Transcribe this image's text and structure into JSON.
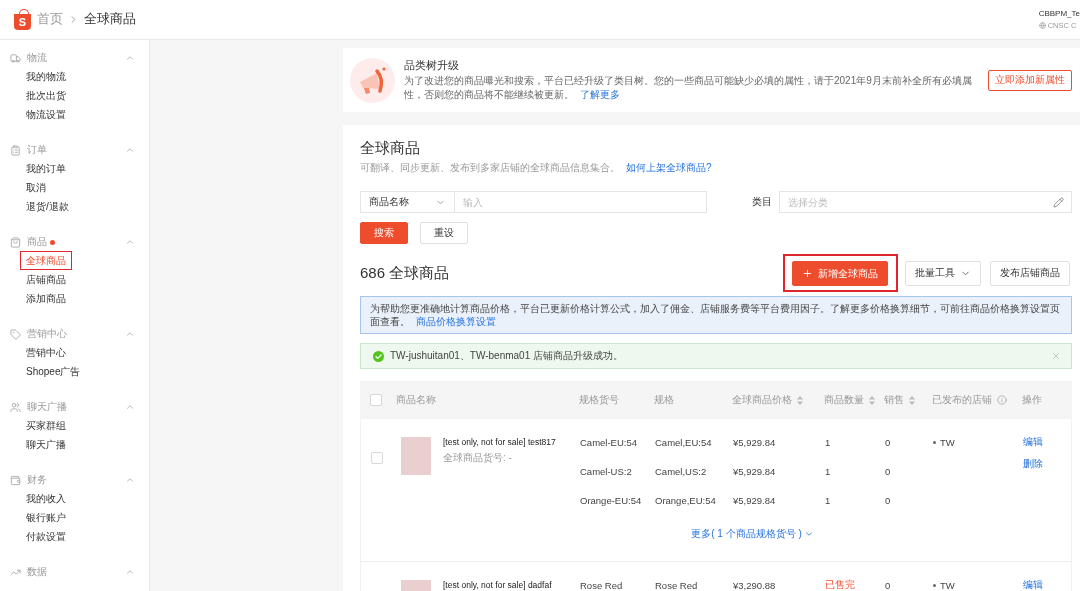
{
  "header": {
    "logo_text": "S",
    "breadcrumb": [
      {
        "label": "首页"
      },
      {
        "label": "全球商品"
      }
    ],
    "account": {
      "name": "CBBPM_Te",
      "shop": "CNSC C"
    }
  },
  "sidebar": {
    "groups": [
      {
        "label": "物流",
        "has_dot": false,
        "expanded": true,
        "items": [
          {
            "label": "我的物流",
            "selected": false
          },
          {
            "label": "批次出货",
            "selected": false
          },
          {
            "label": "物流设置",
            "selected": false
          }
        ]
      },
      {
        "label": "订单",
        "has_dot": false,
        "expanded": true,
        "items": [
          {
            "label": "我的订单",
            "selected": false
          },
          {
            "label": "取消",
            "selected": false
          },
          {
            "label": "退货/退款",
            "selected": false
          }
        ]
      },
      {
        "label": "商品",
        "has_dot": true,
        "expanded": true,
        "items": [
          {
            "label": "全球商品",
            "selected": true
          },
          {
            "label": "店铺商品",
            "selected": false
          },
          {
            "label": "添加商品",
            "selected": false
          }
        ]
      },
      {
        "label": "营销中心",
        "has_dot": false,
        "expanded": true,
        "items": [
          {
            "label": "营销中心",
            "selected": false
          },
          {
            "label": "Shopee广告",
            "selected": false
          }
        ]
      },
      {
        "label": "聊天广播",
        "has_dot": false,
        "expanded": true,
        "items": [
          {
            "label": "买家群组",
            "selected": false
          },
          {
            "label": "聊天广播",
            "selected": false
          }
        ]
      },
      {
        "label": "财务",
        "has_dot": false,
        "expanded": true,
        "items": [
          {
            "label": "我的收入",
            "selected": false
          },
          {
            "label": "银行账户",
            "selected": false
          },
          {
            "label": "付款设置",
            "selected": false
          }
        ]
      },
      {
        "label": "数据",
        "has_dot": false,
        "expanded": true
      }
    ]
  },
  "notice": {
    "title": "品类树升级",
    "text": "为了改进您的商品曝光和搜索，平台已经升级了类目树。您的一些商品可能缺少必填的属性，请于2021年9月末前补全所有必填属性，否则您的商品将不能继续被更新。",
    "link": "了解更多",
    "button": "立即添加新属性"
  },
  "page": {
    "title": "全球商品",
    "subtitle": "可翻译、同步更新、发布到多家店铺的全球商品信息集合。",
    "help_link": "如何上架全球商品?"
  },
  "filters": {
    "type_select": "商品名称",
    "keyword": {
      "placeholder": "输入"
    },
    "category_label": "类目",
    "category": {
      "placeholder": "选择分类"
    },
    "buttons": [
      {
        "kind": "primary",
        "label": "搜索"
      },
      {
        "kind": "default",
        "label": "重设"
      }
    ]
  },
  "list_header": {
    "count_title": "686 全球商品",
    "actions": [
      {
        "kind": "primary",
        "label": "新增全球商品",
        "highlighted": true
      },
      {
        "kind": "dropdown",
        "label": "批量工具",
        "highlighted": false
      },
      {
        "kind": "default",
        "label": "发布店铺商品",
        "highlighted": false
      }
    ]
  },
  "price_notice": {
    "text": "为帮助您更准确地计算商品价格，平台已更新价格计算公式，加入了佣金、店铺服务费等平台费用因子。了解更多价格换算细节，可前往商品价格换算设置页面查看。",
    "link": "商品价格换算设置"
  },
  "success_alert": {
    "text": "TW-jushuitan01、TW-benma01 店铺商品升级成功。"
  },
  "table": {
    "all_checked": false,
    "columns": [
      {
        "label": "商品名称",
        "sortable": false,
        "info": false
      },
      {
        "label": "规格货号",
        "sortable": false,
        "info": false
      },
      {
        "label": "规格",
        "sortable": false,
        "info": false
      },
      {
        "label": "全球商品价格",
        "sortable": true,
        "info": false
      },
      {
        "label": "商品数量",
        "sortable": true,
        "info": false
      },
      {
        "label": "销售",
        "sortable": true,
        "info": false
      },
      {
        "label": "已发布的店铺",
        "sortable": false,
        "info": true
      },
      {
        "label": "操作",
        "sortable": false,
        "info": false
      }
    ],
    "rows": [
      {
        "checked": false,
        "name": "[test only, not for sale] test817",
        "sku": "全球商品货号: -",
        "variations": [
          {
            "sku": "Camel-EU:54",
            "spec": "Camel,EU:54",
            "price": "¥5,929.84",
            "quantity": "1",
            "sold_out": false,
            "sales": "0"
          },
          {
            "sku": "Camel-US:2",
            "spec": "Camel,US:2",
            "price": "¥5,929.84",
            "quantity": "1",
            "sold_out": false,
            "sales": "0"
          },
          {
            "sku": "Orange-EU:54",
            "spec": "Orange,EU:54",
            "price": "¥5,929.84",
            "quantity": "1",
            "sold_out": false,
            "sales": "0"
          }
        ],
        "more": "更多( 1 个商品规格货号 )",
        "shops": [
          "TW"
        ],
        "actions": [
          "编辑",
          "删除"
        ]
      },
      {
        "name": "[test only, not for sale] dadfaf",
        "variations": [
          {
            "sku": "Rose Red",
            "spec": "Rose Red",
            "price": "¥3,290.88",
            "quantity": "已售完",
            "sold_out": true,
            "sales": "0"
          }
        ],
        "shops": [
          "TW"
        ],
        "actions": [
          "编辑"
        ]
      }
    ]
  }
}
